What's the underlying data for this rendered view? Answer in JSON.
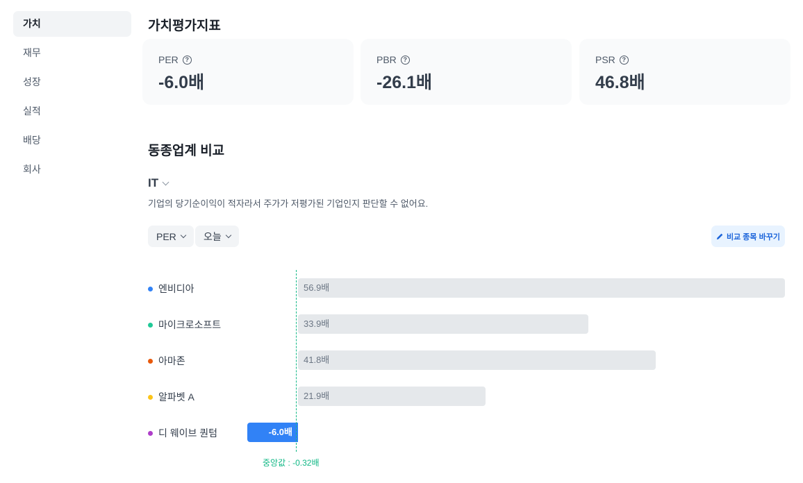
{
  "sidebar": {
    "items": [
      {
        "label": "가치",
        "active": true
      },
      {
        "label": "재무"
      },
      {
        "label": "성장"
      },
      {
        "label": "실적"
      },
      {
        "label": "배당"
      },
      {
        "label": "회사"
      }
    ]
  },
  "valuation": {
    "title": "가치평가지표",
    "cards": [
      {
        "label": "PER",
        "value": "-6.0배"
      },
      {
        "label": "PBR",
        "value": "-26.1배"
      },
      {
        "label": "PSR",
        "value": "46.8배"
      }
    ]
  },
  "peer": {
    "title": "동종업계 비교",
    "industry": "IT",
    "description": "기업의 당기순이익이 적자라서 주가가 저평가된 기업인지 판단할 수 없어요.",
    "metric_select": "PER",
    "period_select": "오늘",
    "change_button": "비교 종목 바꾸기",
    "median_label": "중앙값 : -0.32배"
  },
  "chart_data": {
    "type": "bar",
    "categories": [
      "엔비디아",
      "마이크로소프트",
      "아마존",
      "알파벳 A",
      "디 웨이브 퀀텀"
    ],
    "values": [
      56.9,
      33.9,
      41.8,
      21.9,
      -6.0
    ],
    "value_labels": [
      "56.9배",
      "33.9배",
      "41.8배",
      "21.9배",
      "-6.0배"
    ],
    "dot_colors": [
      "#3182f6",
      "#20c997",
      "#e8590c",
      "#fcc419",
      "#ae3ec9"
    ],
    "bar_color": "#e5e8eb",
    "highlight_color": "#3182f6",
    "median": -0.32,
    "median_color": "#12b886"
  }
}
